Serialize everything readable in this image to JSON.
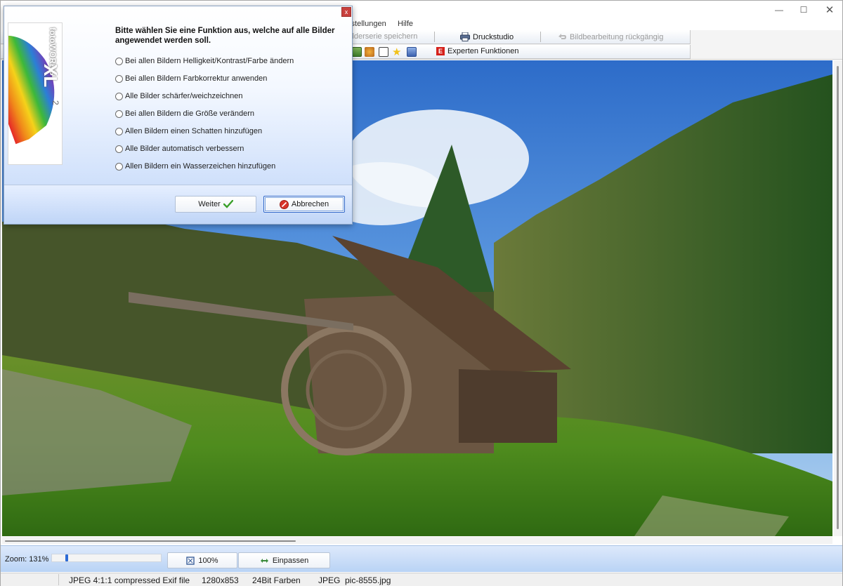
{
  "window": {
    "controls": [
      "minimize-icon",
      "maximize-icon",
      "close-icon"
    ]
  },
  "menu": {
    "items": [
      "instellungen",
      "Hilfe"
    ]
  },
  "toolbar": {
    "row1": {
      "save_series": "ilderserie speichern",
      "print_studio": "Druckstudio",
      "undo_edit": "Bildbearbeitung rückgängig"
    },
    "row2": {
      "expert_functions": "Experten Funktionen",
      "expert_badge": "E"
    }
  },
  "dialog": {
    "close_glyph": "x",
    "logo_text": "fotoWORKS",
    "logo_mark": "XL",
    "logo_version": "2",
    "heading": "Bitte wählen Sie eine Funktion aus, welche auf alle Bilder angewendet werden soll.",
    "options": [
      "Bei allen Bildern Helligkeit/Kontrast/Farbe ändern",
      "Bei allen Bildern Farbkorrektur anwenden",
      "Alle Bilder schärfer/weichzeichnen",
      "Bei allen Bildern die Größe verändern",
      "Allen Bildern einen Schatten hinzufügen",
      "Alle Bilder automatisch verbessern",
      "Allen Bildern ein Wasserzeichen hinzufügen"
    ],
    "next_label": "Weiter",
    "cancel_label": "Abbrechen"
  },
  "zoom": {
    "label": "Zoom: 131%",
    "value_percent": 131,
    "slider_fraction": 0.13,
    "btn_100": "100%",
    "btn_fit": "Einpassen"
  },
  "status": {
    "format": "JPEG 4:1:1 compressed Exif file",
    "dimensions": "1280x853",
    "colors": "24Bit Farben",
    "type": "JPEG",
    "filename": "pic-8555.jpg"
  }
}
